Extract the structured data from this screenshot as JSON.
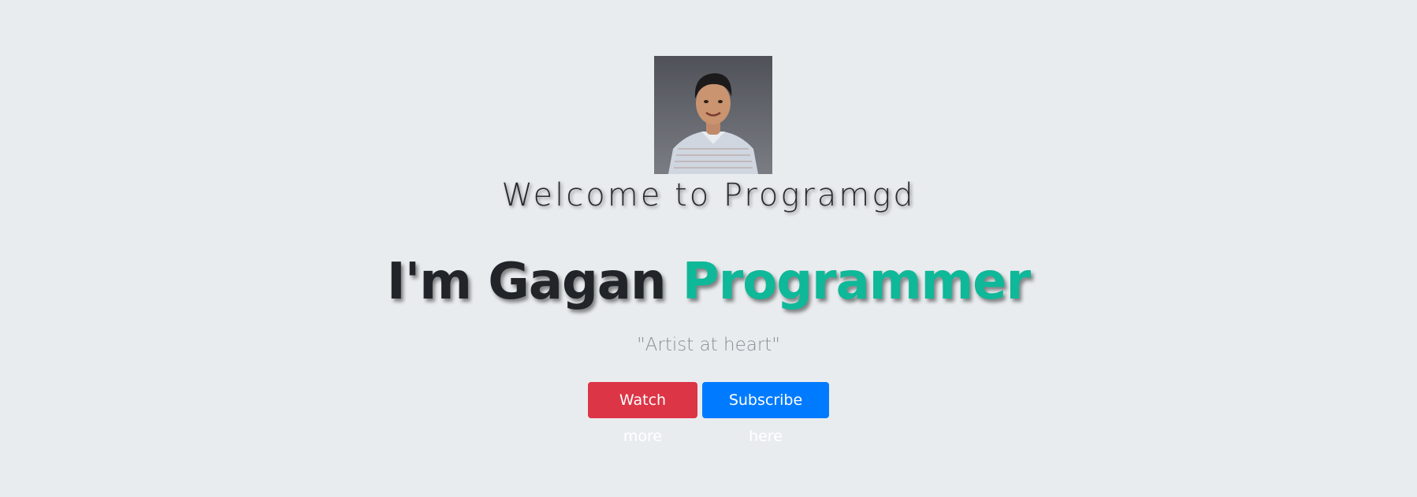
{
  "colors": {
    "background": "#e9ecef",
    "role_accent": "#0fb898",
    "watch_button": "#dc3545",
    "subscribe_button": "#007bff",
    "quote_text": "#868e96"
  },
  "profile": {
    "avatar_alt": "profile photo"
  },
  "hero": {
    "welcome": "Welcome to Programgd",
    "intro": "I'm Gagan",
    "role": "Programmer",
    "quote": "\"Artist at heart\""
  },
  "actions": {
    "watch_label": "Watch more",
    "subscribe_label": "Subscribe here"
  }
}
